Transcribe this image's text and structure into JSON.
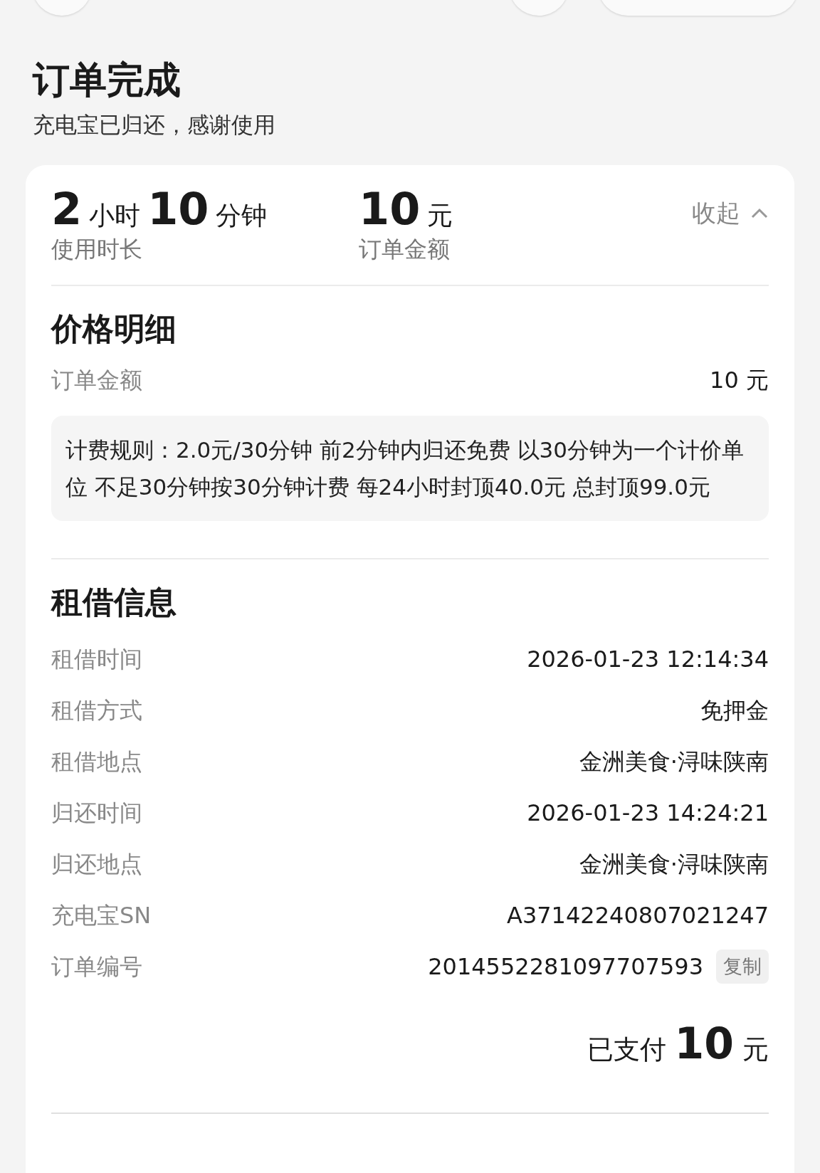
{
  "title": "订单完成",
  "subtitle": "充电宝已归还，感谢使用",
  "summary": {
    "stats": [
      {
        "parts": [
          {
            "text": "2",
            "kind": "number"
          },
          {
            "text": "小时",
            "kind": "unit"
          },
          {
            "text": "10",
            "kind": "number"
          },
          {
            "text": "分钟",
            "kind": "unit"
          }
        ],
        "label": "使用时长"
      },
      {
        "parts": [
          {
            "text": "10",
            "kind": "number"
          },
          {
            "text": "元",
            "kind": "unit"
          }
        ],
        "label": "订单金额"
      }
    ],
    "toggle": {
      "label": "收起",
      "expanded": true
    }
  },
  "price_detail": {
    "heading": "价格明细",
    "rows": [
      {
        "label": "订单金额",
        "value": "10 元"
      }
    ],
    "rule": "计费规则：2.0元/30分钟 前2分钟内归还免费 以30分钟为一个计价单位 不足30分钟按30分钟计费 每24小时封顶40.0元 总封顶99.0元"
  },
  "rental_info": {
    "heading": "租借信息",
    "rows": [
      {
        "label": "租借时间",
        "value": "2026-01-23 12:14:34"
      },
      {
        "label": "租借方式",
        "value": "免押金"
      },
      {
        "label": "租借地点",
        "value": "金洲美食·浔味陕南"
      },
      {
        "label": "归还时间",
        "value": "2026-01-23 14:24:21"
      },
      {
        "label": "归还地点",
        "value": "金洲美食·浔味陕南"
      },
      {
        "label": "充电宝SN",
        "value": "A37142240807021247"
      },
      {
        "label": "订单编号",
        "value": "2014552281097707593",
        "action": "复制"
      }
    ]
  },
  "paid": {
    "label": "已支付",
    "amount": "10",
    "unit": "元"
  }
}
